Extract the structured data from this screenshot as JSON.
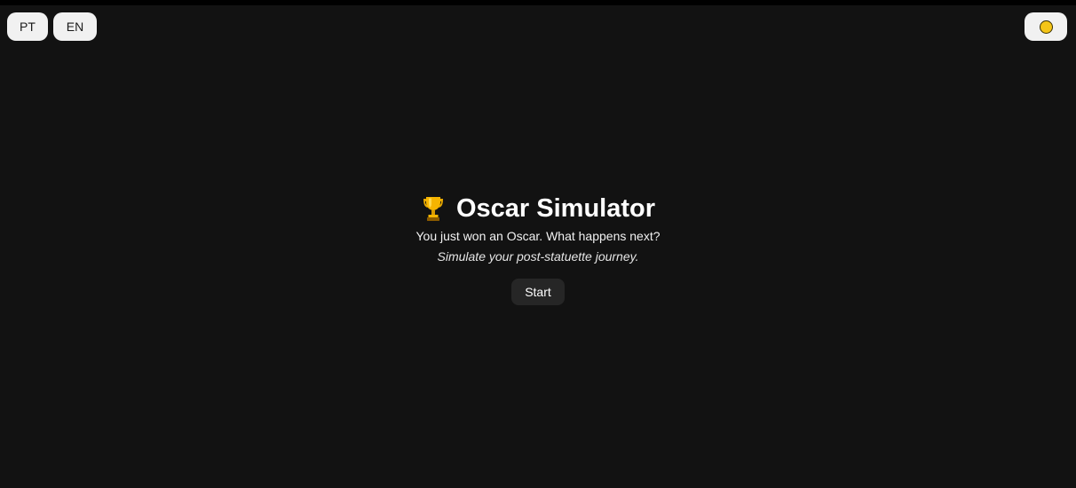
{
  "language_switcher": {
    "options": [
      {
        "label": "PT"
      },
      {
        "label": "EN"
      }
    ]
  },
  "theme_toggle": {
    "icon": "sun-icon",
    "color": "#f5c518"
  },
  "hero": {
    "icon": "trophy-icon",
    "title": "Oscar Simulator",
    "subtitle": "You just won an Oscar. What happens next?",
    "tagline": "Simulate your post-statuette journey.",
    "start_label": "Start"
  },
  "colors": {
    "background": "#121212",
    "pill_background": "#f1f1f1",
    "start_background": "#262626",
    "accent_gold": "#f5c518"
  }
}
